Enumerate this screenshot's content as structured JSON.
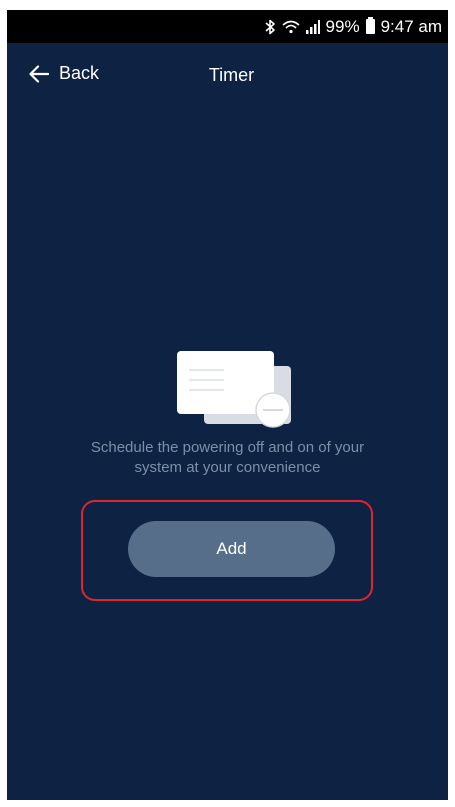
{
  "status_bar": {
    "bluetooth_icon": "bluetooth-icon",
    "wifi_icon": "wifi-icon",
    "signal_icon": "signal-icon",
    "battery_percent": "99%",
    "battery_icon": "battery-icon",
    "time": "9:47 am"
  },
  "header": {
    "back_label": "Back",
    "back_icon": "arrow-left-icon",
    "title": "Timer"
  },
  "empty_state": {
    "illustration": "schedule-cards-illustration",
    "description_line1": "Schedule the powering off and on of your",
    "description_line2": "system at your convenience"
  },
  "actions": {
    "add_label": "Add"
  },
  "colors": {
    "background": "#0e2244",
    "button": "#566e89",
    "description_text": "#7d8fa8",
    "highlight": "#e0242f"
  }
}
